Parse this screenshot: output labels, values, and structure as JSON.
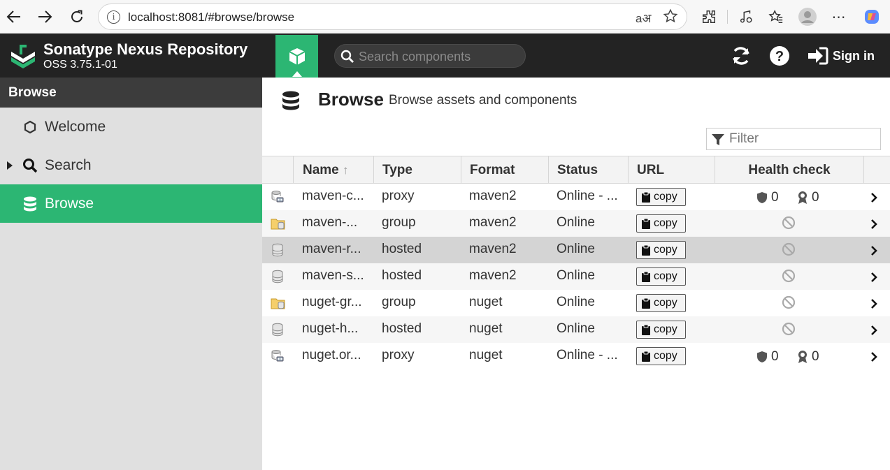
{
  "browser": {
    "url": "localhost:8081/#browse/browse"
  },
  "header": {
    "title": "Sonatype Nexus Repository",
    "version": "OSS 3.75.1-01",
    "search_placeholder": "Search components",
    "signin_label": "Sign in"
  },
  "sidebar": {
    "heading": "Browse",
    "items": [
      {
        "label": "Welcome"
      },
      {
        "label": "Search"
      },
      {
        "label": "Browse"
      }
    ]
  },
  "main": {
    "title": "Browse",
    "subtitle": "Browse assets and components",
    "filter_placeholder": "Filter",
    "columns": {
      "name": "Name",
      "type": "Type",
      "format": "Format",
      "status": "Status",
      "url": "URL",
      "health": "Health check"
    },
    "copy_label": "copy",
    "rows": [
      {
        "name": "maven-c...",
        "type": "proxy",
        "format": "maven2",
        "status": "Online - ...",
        "icon": "proxy-repo-icon",
        "health": {
          "security": "0",
          "license": "0"
        }
      },
      {
        "name": "maven-...",
        "type": "group",
        "format": "maven2",
        "status": "Online",
        "icon": "group-repo-icon",
        "health": null
      },
      {
        "name": "maven-r...",
        "type": "hosted",
        "format": "maven2",
        "status": "Online",
        "icon": "hosted-repo-icon",
        "health": null
      },
      {
        "name": "maven-s...",
        "type": "hosted",
        "format": "maven2",
        "status": "Online",
        "icon": "hosted-repo-icon",
        "health": null
      },
      {
        "name": "nuget-gr...",
        "type": "group",
        "format": "nuget",
        "status": "Online",
        "icon": "group-repo-icon",
        "health": null
      },
      {
        "name": "nuget-h...",
        "type": "hosted",
        "format": "nuget",
        "status": "Online",
        "icon": "hosted-repo-icon",
        "health": null
      },
      {
        "name": "nuget.or...",
        "type": "proxy",
        "format": "nuget",
        "status": "Online - ...",
        "icon": "proxy-repo-icon",
        "health": {
          "security": "0",
          "license": "0"
        }
      }
    ]
  },
  "colors": {
    "accent": "#2cb673",
    "header_bg": "#232323",
    "sidebar_bg": "#e0e0e0"
  }
}
